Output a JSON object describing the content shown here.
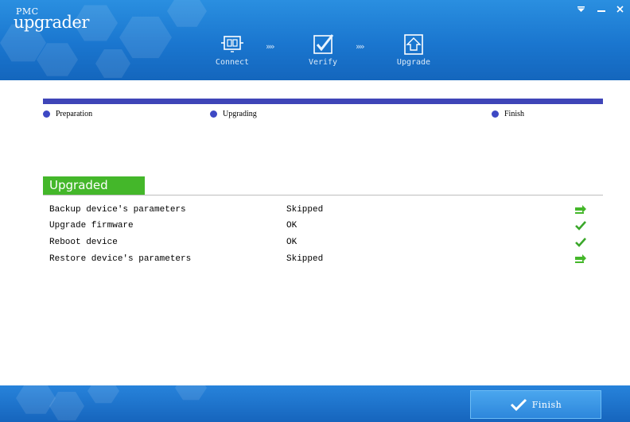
{
  "app": {
    "logo_small": "PMC",
    "logo_big": "upgrader",
    "accent": "#1a76cf"
  },
  "window_controls": {
    "menu_icon": "dropdown-triangle-icon",
    "minimize_icon": "minimize-icon",
    "close_icon": "close-icon"
  },
  "wizard_steps": [
    {
      "label": "Connect",
      "icon": "connect-icon"
    },
    {
      "label": "Verify",
      "icon": "verify-icon"
    },
    {
      "label": "Upgrade",
      "icon": "upgrade-icon"
    }
  ],
  "step_separator": "››››",
  "phases": [
    {
      "label": "Preparation"
    },
    {
      "label": "Upgrading"
    },
    {
      "label": "Finish"
    }
  ],
  "section": {
    "title": "Upgraded",
    "color": "#44b72a"
  },
  "results": [
    {
      "task": "Backup device's parameters",
      "result": "Skipped",
      "status_icon": "skipped-arrow-icon"
    },
    {
      "task": "Upgrade firmware",
      "result": "OK",
      "status_icon": "check-icon"
    },
    {
      "task": "Reboot device",
      "result": "OK",
      "status_icon": "check-icon"
    },
    {
      "task": "Restore device's parameters",
      "result": "Skipped",
      "status_icon": "skipped-arrow-icon"
    }
  ],
  "footer": {
    "finish_label": "Finish",
    "finish_icon": "check-icon"
  }
}
